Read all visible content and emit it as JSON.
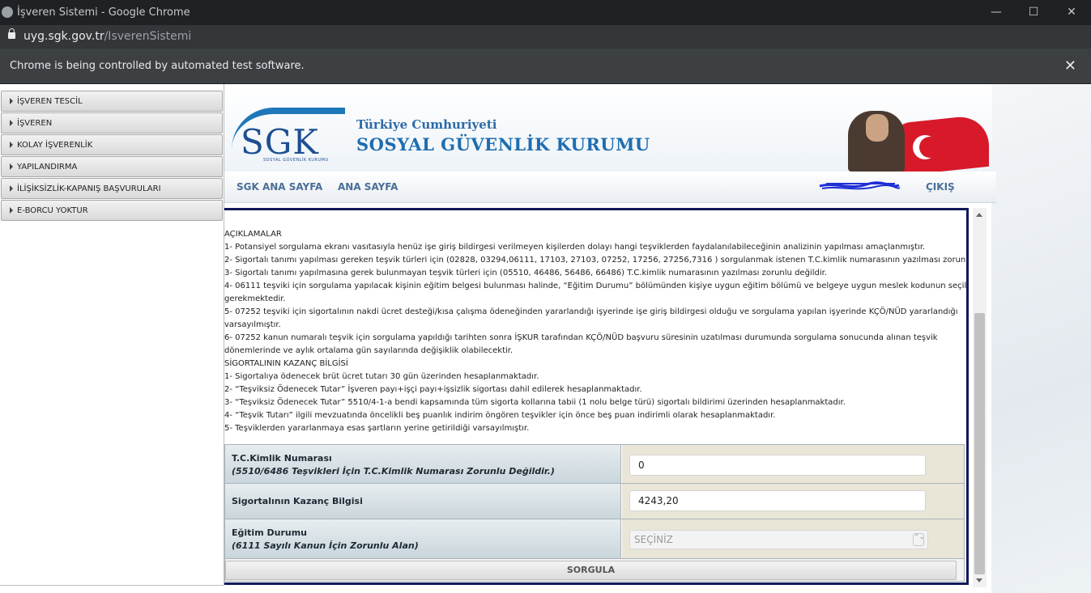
{
  "window": {
    "title": "İşveren Sistemi - Google Chrome",
    "minimize": "—",
    "maximize": "☐",
    "close": "✕"
  },
  "address": {
    "domain": "uyg.sgk.gov.tr",
    "path": "/IsverenSistemi"
  },
  "infobar": {
    "message": "Chrome is being controlled by automated test software.",
    "close": "✕"
  },
  "menu": {
    "items": [
      {
        "label": "İŞVEREN TESCİL"
      },
      {
        "label": "İŞVEREN"
      },
      {
        "label": "KOLAY İŞVERENLİK"
      },
      {
        "label": "YAPILANDIRMA"
      },
      {
        "label": "İLİŞİKSİZLİK-KAPANIŞ BAŞVURULARI"
      },
      {
        "label": "E-BORCU YOKTUR"
      }
    ]
  },
  "header": {
    "logo": "SGK",
    "logo_sub": "SOSYAL GÜVENLİK KURUMU",
    "line1": "Türkiye Cumhuriyeti",
    "line2": "SOSYAL GÜVENLİK KURUMU"
  },
  "nav": {
    "sgk_home": "SGK ANA SAYFA",
    "home": "ANA SAYFA",
    "logout": "ÇIKIŞ"
  },
  "explanations": [
    "AÇIKLAMALAR",
    "1- Potansiyel sorgulama ekranı vasıtasıyla henüz işe giriş bildirgesi verilmeyen kişilerden dolayı hangi teşviklerden faydalanılabileceğinin analizinin yapılması amaçlanmıştır.",
    "2- Sigortalı tanımı yapılması gereken teşvik türleri için (02828, 03294,06111, 17103, 27103, 07252, 17256, 27256,7316 ) sorgulanmak istenen T.C.kimlik numarasının yazılması zorunludur.",
    "3- Sigortalı tanımı yapılmasına gerek bulunmayan teşvik türleri için (05510, 46486, 56486, 66486) T.C.kimlik numarasının yazılması zorunlu değildir.",
    "4- 06111 teşviki için sorgulama yapılacak kişinin eğitim belgesi bulunması halinde, “Eğitim Durumu” bölümünden kişiye uygun eğitim bölümü ve belgeye uygun meslek kodunun seçilmesi",
    "gerekmektedir.",
    "5- 07252 teşviki için sigortalının nakdi ücret desteği/kısa çalışma ödeneğinden yararlandığı işyerinde işe giriş bildirgesi olduğu ve sorgulama yapılan işyerinde KÇÖ/NÜD yararlandığı",
    "varsayılmıştır.",
    "6- 07252 kanun numaralı teşvik için sorgulama yapıldığı tarihten sonra İŞKUR tarafından KÇÖ/NÜD başvuru süresinin uzatılması durumunda sorgulama sonucunda alınan teşvik",
    "dönemlerinde ve aylık ortalama gün sayılarında değişiklik olabilecektir.",
    "SİGORTALININ KAZANÇ BİLGİSİ",
    "1- Sigortalıya ödenecek brüt ücret tutarı 30 gün üzerinden hesaplanmaktadır.",
    "2- “Teşviksiz Ödenecek Tutar” İşveren payı+işçi payı+işsizlik sigortası dahil edilerek hesaplanmaktadır.",
    "3- “Teşviksiz Ödenecek Tutar” 5510/4-1-a bendi kapsamında tüm sigorta kollarına tabii (1 nolu belge türü) sigortalı bildirimi üzerinden hesaplanmaktadır.",
    "4- “Teşvik Tutarı” ilgili mevzuatında öncelikli beş puanlık indirim öngören teşvikler için önce beş puan indirimli olarak hesaplanmaktadır.",
    "5- Teşviklerden yararlanmaya esas şartların yerine getirildiği varsayılmıştır."
  ],
  "form": {
    "tc": {
      "label": "T.C.Kimlik Numarası",
      "note": "(5510/6486 Teşvikleri İçin T.C.Kimlik Numarası Zorunlu Değildir.)",
      "value": "0"
    },
    "earnings": {
      "label": "Sigortalının Kazanç Bilgisi",
      "value": "4243,20"
    },
    "education": {
      "label": "Eğitim Durumu",
      "note": "(6111 Sayılı Kanun İçin Zorunlu Alan)",
      "selected": "SEÇİNİZ",
      "caret": "⌃⌄"
    },
    "submit": "SORGULA"
  }
}
